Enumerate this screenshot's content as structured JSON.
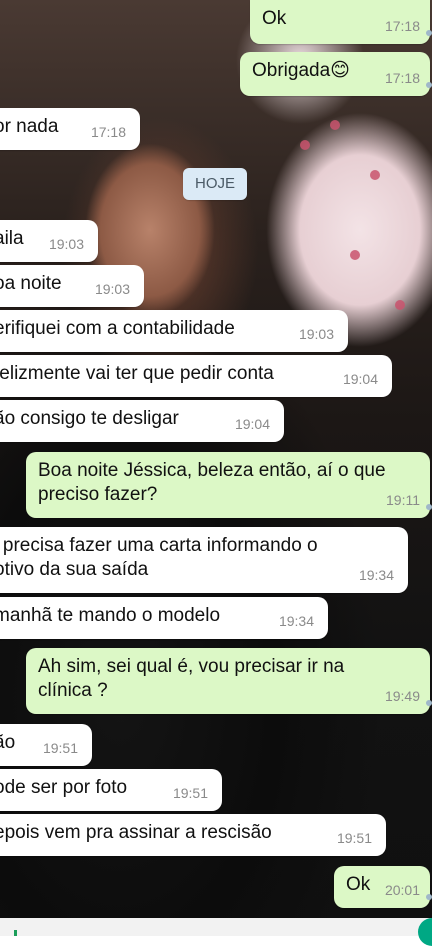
{
  "date_divider": "HOJE",
  "messages": [
    {
      "dir": "out",
      "text": "Ok",
      "time": "17:18"
    },
    {
      "dir": "out",
      "text": "Obrigada",
      "emoji": "😊",
      "time": "17:18"
    },
    {
      "dir": "in",
      "text": "or nada",
      "time": "17:18"
    },
    {
      "dir": "in",
      "text": "aila",
      "time": "19:03"
    },
    {
      "dir": "in",
      "text": "oa noite",
      "time": "19:03"
    },
    {
      "dir": "in",
      "text": "erifiquei com a contabilidade",
      "time": "19:03"
    },
    {
      "dir": "in",
      "text": "felizmente vai ter que pedir conta",
      "time": "19:04"
    },
    {
      "dir": "in",
      "text": "ão consigo te desligar",
      "time": "19:04"
    },
    {
      "dir": "out",
      "text": "Boa noite Jéssica, beleza então, aí o que",
      "text2": "preciso fazer?",
      "time": "19:11"
    },
    {
      "dir": "in",
      "text": "ʹ precisa fazer uma carta informando o",
      "text2": "otivo da sua saída",
      "time": "19:34"
    },
    {
      "dir": "in",
      "text": "manhã te mando o modelo",
      "time": "19:34"
    },
    {
      "dir": "out",
      "text": "Ah sim, sei qual é, vou precisar ir na",
      "text2": "clínica ?",
      "time": "19:49"
    },
    {
      "dir": "in",
      "text": "ão",
      "time": "19:51"
    },
    {
      "dir": "in",
      "text": "ode ser por foto",
      "time": "19:51"
    },
    {
      "dir": "in",
      "text": "epois vem pra assinar a rescisão",
      "time": "19:51"
    },
    {
      "dir": "out",
      "text": "Ok",
      "time": "20:01"
    }
  ],
  "colors": {
    "incoming_bubble": "#ffffff",
    "outgoing_bubble": "#dcf8c6",
    "date_chip": "#dbeaf6",
    "accent": "#00a884"
  }
}
